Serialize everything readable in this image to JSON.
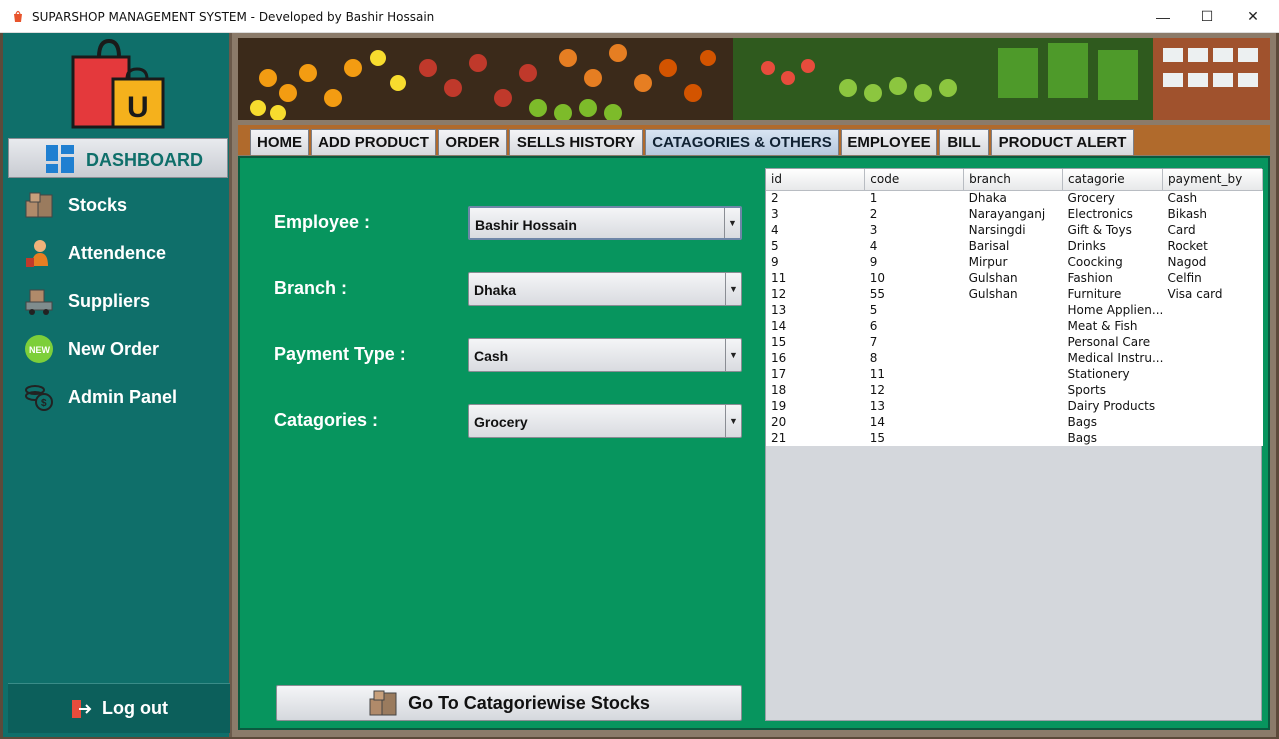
{
  "window": {
    "title": "SUPARSHOP MANAGEMENT SYSTEM  - Developed by Bashir Hossain",
    "minimize": "—",
    "maximize": "☐",
    "close": "✕"
  },
  "sidebar": {
    "dashboard_label": "DASHBOARD",
    "items": [
      {
        "label": "Stocks",
        "icon": "boxes-icon"
      },
      {
        "label": "Attendence",
        "icon": "worker-icon"
      },
      {
        "label": "Suppliers",
        "icon": "delivery-truck-icon"
      },
      {
        "label": "New Order",
        "icon": "new-badge-icon"
      },
      {
        "label": "Admin Panel",
        "icon": "coins-icon"
      }
    ],
    "logout_label": "Log out"
  },
  "tabs": [
    {
      "label": "HOME"
    },
    {
      "label": "ADD PRODUCT"
    },
    {
      "label": "ORDER"
    },
    {
      "label": "SELLS HISTORY"
    },
    {
      "label": "CATAGORIES & OTHERS",
      "active": true
    },
    {
      "label": "EMPLOYEE"
    },
    {
      "label": "BILL"
    },
    {
      "label": "PRODUCT ALERT"
    }
  ],
  "form": {
    "employee_label": "Employee :",
    "employee_value": "Bashir Hossain",
    "branch_label": "Branch :",
    "branch_value": "Dhaka",
    "payment_label": "Payment Type :",
    "payment_value": "Cash",
    "category_label": "Catagories :",
    "category_value": "Grocery",
    "goto_label": "Go To Catagoriewise Stocks"
  },
  "table": {
    "columns": [
      "id",
      "code",
      "branch",
      "catagorie",
      "payment_by"
    ],
    "rows": [
      [
        "2",
        "1",
        "Dhaka",
        "Grocery",
        "Cash"
      ],
      [
        "3",
        "2",
        "Narayanganj",
        "Electronics",
        "Bikash"
      ],
      [
        "4",
        "3",
        "Narsingdi",
        "Gift & Toys",
        "Card"
      ],
      [
        "5",
        "4",
        "Barisal",
        "Drinks",
        "Rocket"
      ],
      [
        "9",
        "9",
        "Mirpur",
        "Coocking",
        "Nagod"
      ],
      [
        "11",
        "10",
        "Gulshan",
        "Fashion",
        "Celfin"
      ],
      [
        "12",
        "55",
        "Gulshan",
        "Furniture",
        "Visa card"
      ],
      [
        "13",
        "5",
        "",
        "Home Applien...",
        ""
      ],
      [
        "14",
        "6",
        "",
        "Meat & Fish",
        ""
      ],
      [
        "15",
        "7",
        "",
        "Personal Care",
        ""
      ],
      [
        "16",
        "8",
        "",
        "Medical Instru...",
        ""
      ],
      [
        "17",
        "11",
        "",
        "Stationery",
        ""
      ],
      [
        "18",
        "12",
        "",
        "Sports",
        ""
      ],
      [
        "19",
        "13",
        "",
        "Dairy Products",
        ""
      ],
      [
        "20",
        "14",
        "",
        "Bags",
        ""
      ],
      [
        "21",
        "15",
        "",
        "Bags",
        ""
      ]
    ]
  },
  "colors": {
    "sidebar": "#0f6f6a",
    "content": "#07955e",
    "tabbar": "#b06a2c"
  }
}
